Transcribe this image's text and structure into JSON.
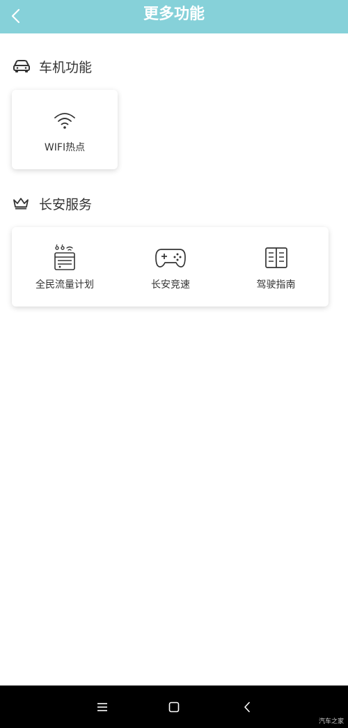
{
  "header": {
    "title": "更多功能",
    "back_icon": "chevron-left-icon",
    "background": "#86d1d9"
  },
  "vehicle_section": {
    "icon": "car-icon",
    "title": "车机功能",
    "items": [
      {
        "label": "WIFI热点",
        "icon": "wifi-icon"
      }
    ]
  },
  "service_section": {
    "icon": "crown-icon",
    "title": "长安服务",
    "items": [
      {
        "label": "全民流量计划",
        "icon": "data-plan-icon"
      },
      {
        "label": "长安竞速",
        "icon": "gamepad-icon"
      },
      {
        "label": "驾驶指南",
        "icon": "book-icon"
      }
    ]
  },
  "navbar": {
    "menu_icon": "menu-icon",
    "home_icon": "home-square-icon",
    "back_icon": "back-arrow-icon",
    "watermark": "汽车之家"
  }
}
